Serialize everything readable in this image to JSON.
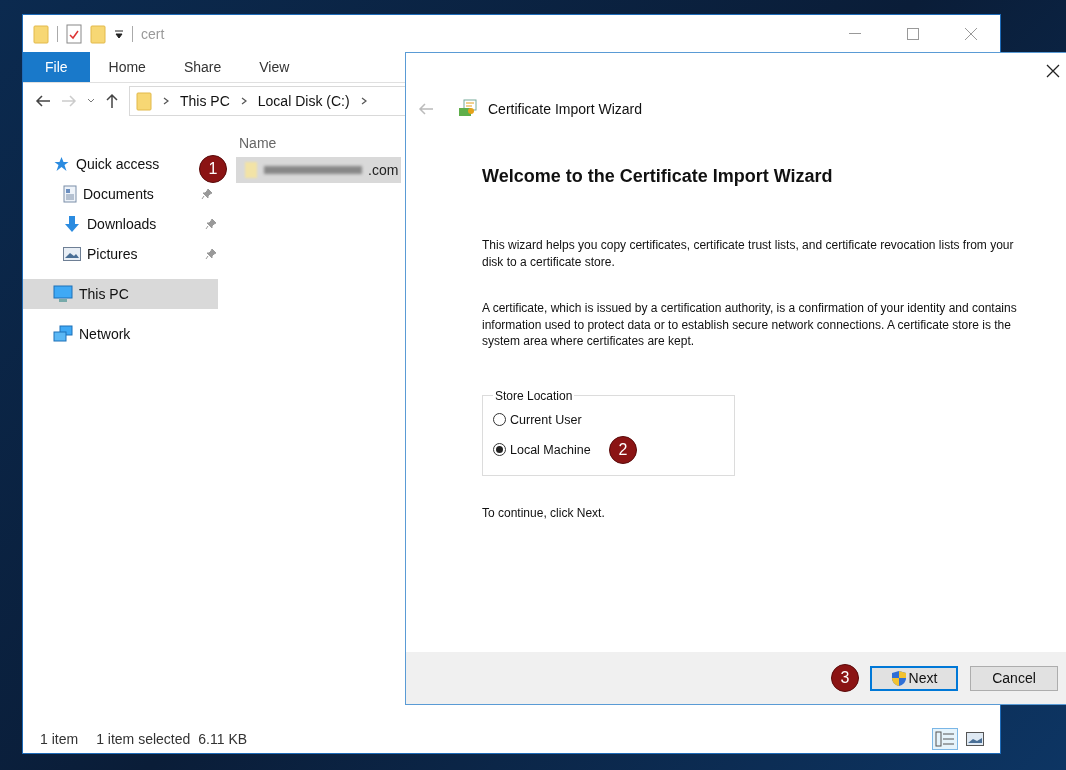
{
  "explorer": {
    "title": "cert",
    "ribbon_tabs": [
      {
        "label": "File",
        "selected": true
      },
      {
        "label": "Home",
        "selected": false
      },
      {
        "label": "Share",
        "selected": false
      },
      {
        "label": "View",
        "selected": false
      }
    ],
    "breadcrumb": [
      "This PC",
      "Local Disk (C:)"
    ],
    "nav": [
      {
        "label": "Quick access",
        "kind": "star",
        "selected": false,
        "children": [
          {
            "label": "Documents",
            "kind": "documents",
            "pinned": true,
            "selected": false
          },
          {
            "label": "Downloads",
            "kind": "downloads",
            "pinned": true,
            "selected": false
          },
          {
            "label": "Pictures",
            "kind": "pictures",
            "pinned": true,
            "selected": false
          }
        ]
      },
      {
        "label": "This PC",
        "kind": "pc",
        "selected": true
      },
      {
        "label": "Network",
        "kind": "network",
        "selected": false
      }
    ],
    "column": "Name",
    "files": [
      {
        "name": ".com",
        "selected": true,
        "marker": "1"
      }
    ],
    "status": [
      "1 item",
      "1 item selected",
      "6.11 KB"
    ],
    "view_buttons": [
      {
        "kind": "details",
        "selected": true
      },
      {
        "kind": "thumbnails",
        "selected": false
      }
    ]
  },
  "wizard": {
    "title": "Certificate Import Wizard",
    "heading": "Welcome to the Certificate Import Wizard",
    "paragraphs": [
      "This wizard helps you copy certificates, certificate trust lists, and certificate revocation lists from your disk to a certificate store.",
      "A certificate, which is issued by a certification authority, is a confirmation of your identity and contains information used to protect data or to establish secure network connections. A certificate store is the system area where certificates are kept."
    ],
    "store_location": {
      "legend": "Store Location",
      "options": [
        {
          "label": "Current User",
          "selected": false
        },
        {
          "label": "Local Machine",
          "selected": true,
          "marker": "2"
        }
      ]
    },
    "instruction": "To continue, click Next.",
    "buttons": [
      {
        "label": "Next",
        "kind": "primary",
        "marker": "3"
      },
      {
        "label": "Cancel",
        "kind": "normal"
      }
    ]
  }
}
